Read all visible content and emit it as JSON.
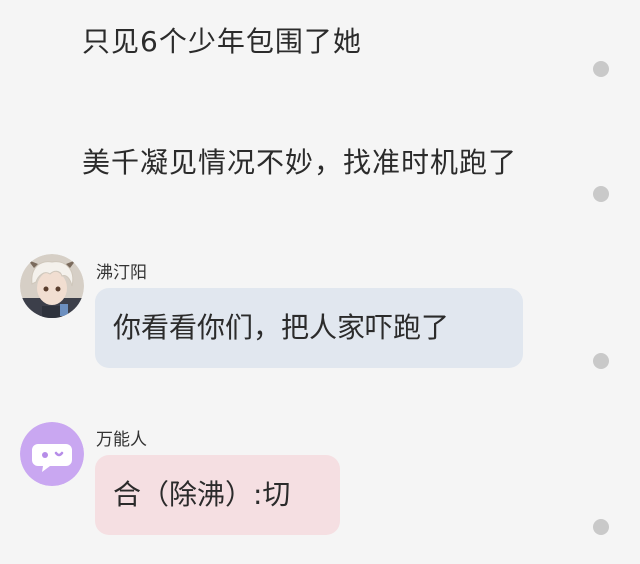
{
  "narrations": [
    "只见6个少年包围了她",
    "美千凝见情况不妙，找准时机跑了"
  ],
  "messages": [
    {
      "speaker": "沸汀阳",
      "text": "你看看你们，把人家吓跑了",
      "bubble_color": "#e1e7ef"
    },
    {
      "speaker": "万能人",
      "text": "合（除沸）:切",
      "bubble_color": "#f5dfe2"
    }
  ],
  "colors": {
    "background": "#f5f5f5",
    "dot": "#c9c9c9",
    "avatar_purple": "#c9a7f1"
  },
  "icons": [
    "avatar-fluffy-white-hair-character",
    "chat-bubble-icon"
  ]
}
